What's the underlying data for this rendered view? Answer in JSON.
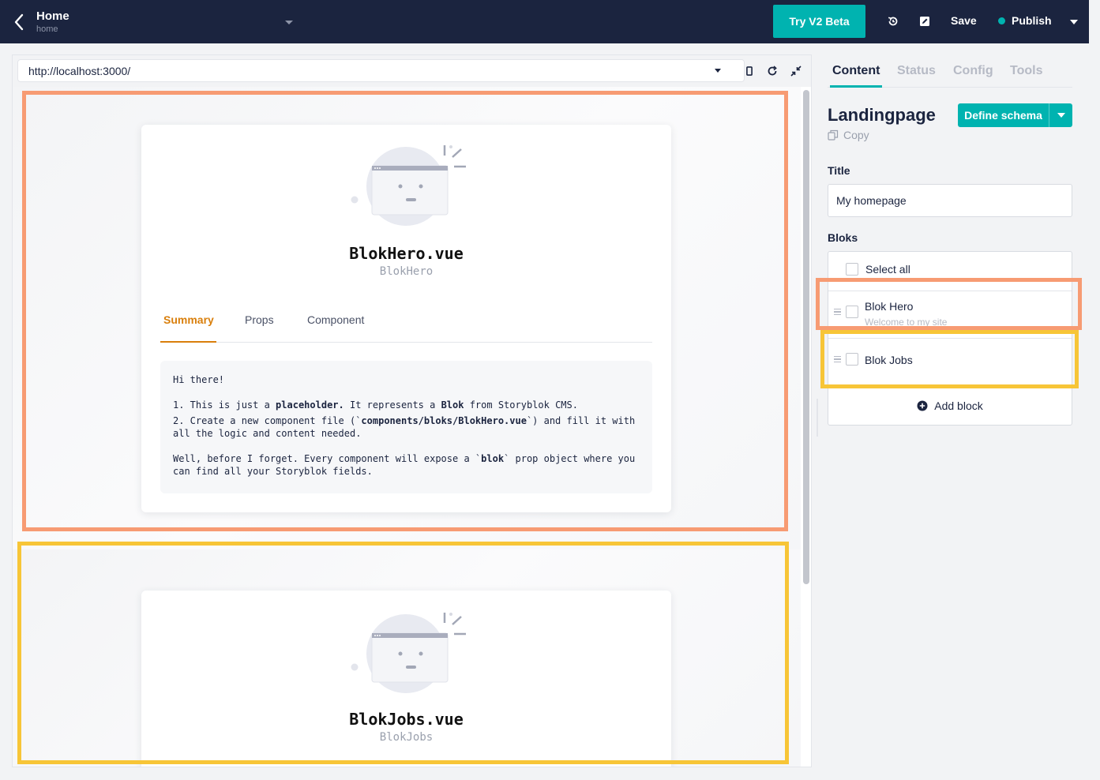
{
  "topbar": {
    "story_title": "Home",
    "story_slug": "home",
    "try_beta_label": "Try V2 Beta",
    "save_label": "Save",
    "publish_label": "Publish",
    "colors": {
      "bar_bg": "#1b243f",
      "accent": "#00b3b0"
    }
  },
  "preview": {
    "url": "http://localhost:3000/",
    "hero": {
      "name": "BlokHero.vue",
      "sub": "BlokHero",
      "tabs": [
        "Summary",
        "Props",
        "Component"
      ],
      "summary": {
        "greeting": "Hi there!",
        "line1_a": "1. This is just a ",
        "line1_b": "placeholder.",
        "line1_c": " It represents a ",
        "line1_d": "Blok",
        "line1_e": " from Storyblok CMS.",
        "line2_a": "2. Create a new component file (`",
        "line2_b": "components/bloks/BlokHero.vue",
        "line2_c": "`) and fill it with all the logic and content needed.",
        "line3_a": "Well, before I forget. Every component will expose a `",
        "line3_b": "blok",
        "line3_c": "` prop object where you can find all your Storyblok fields."
      }
    },
    "jobs": {
      "name": "BlokJobs.vue",
      "sub": "BlokJobs"
    },
    "highlight_colors": {
      "hero": "#f79b73",
      "jobs": "#f7c537",
      "tab_active": "#d97f0c"
    }
  },
  "panel": {
    "tabs": [
      "Content",
      "Status",
      "Config",
      "Tools"
    ],
    "content_type": "Landingpage",
    "copy_label": "Copy",
    "define_schema_label": "Define schema",
    "title_label": "Title",
    "title_value": "My homepage",
    "bloks_label": "Bloks",
    "select_all_label": "Select all",
    "bloks": [
      {
        "title": "Blok Hero",
        "subtitle": "Welcome to my site"
      },
      {
        "title": "Blok Jobs",
        "subtitle": ""
      }
    ],
    "add_block_label": "Add block"
  },
  "icons": [
    "back-arrow-icon",
    "caret-down-icon",
    "history-icon",
    "edit-icon",
    "mobile-icon",
    "refresh-icon",
    "collapse-icon",
    "copy-icon",
    "drag-handle-icon",
    "plus-circle-icon"
  ]
}
